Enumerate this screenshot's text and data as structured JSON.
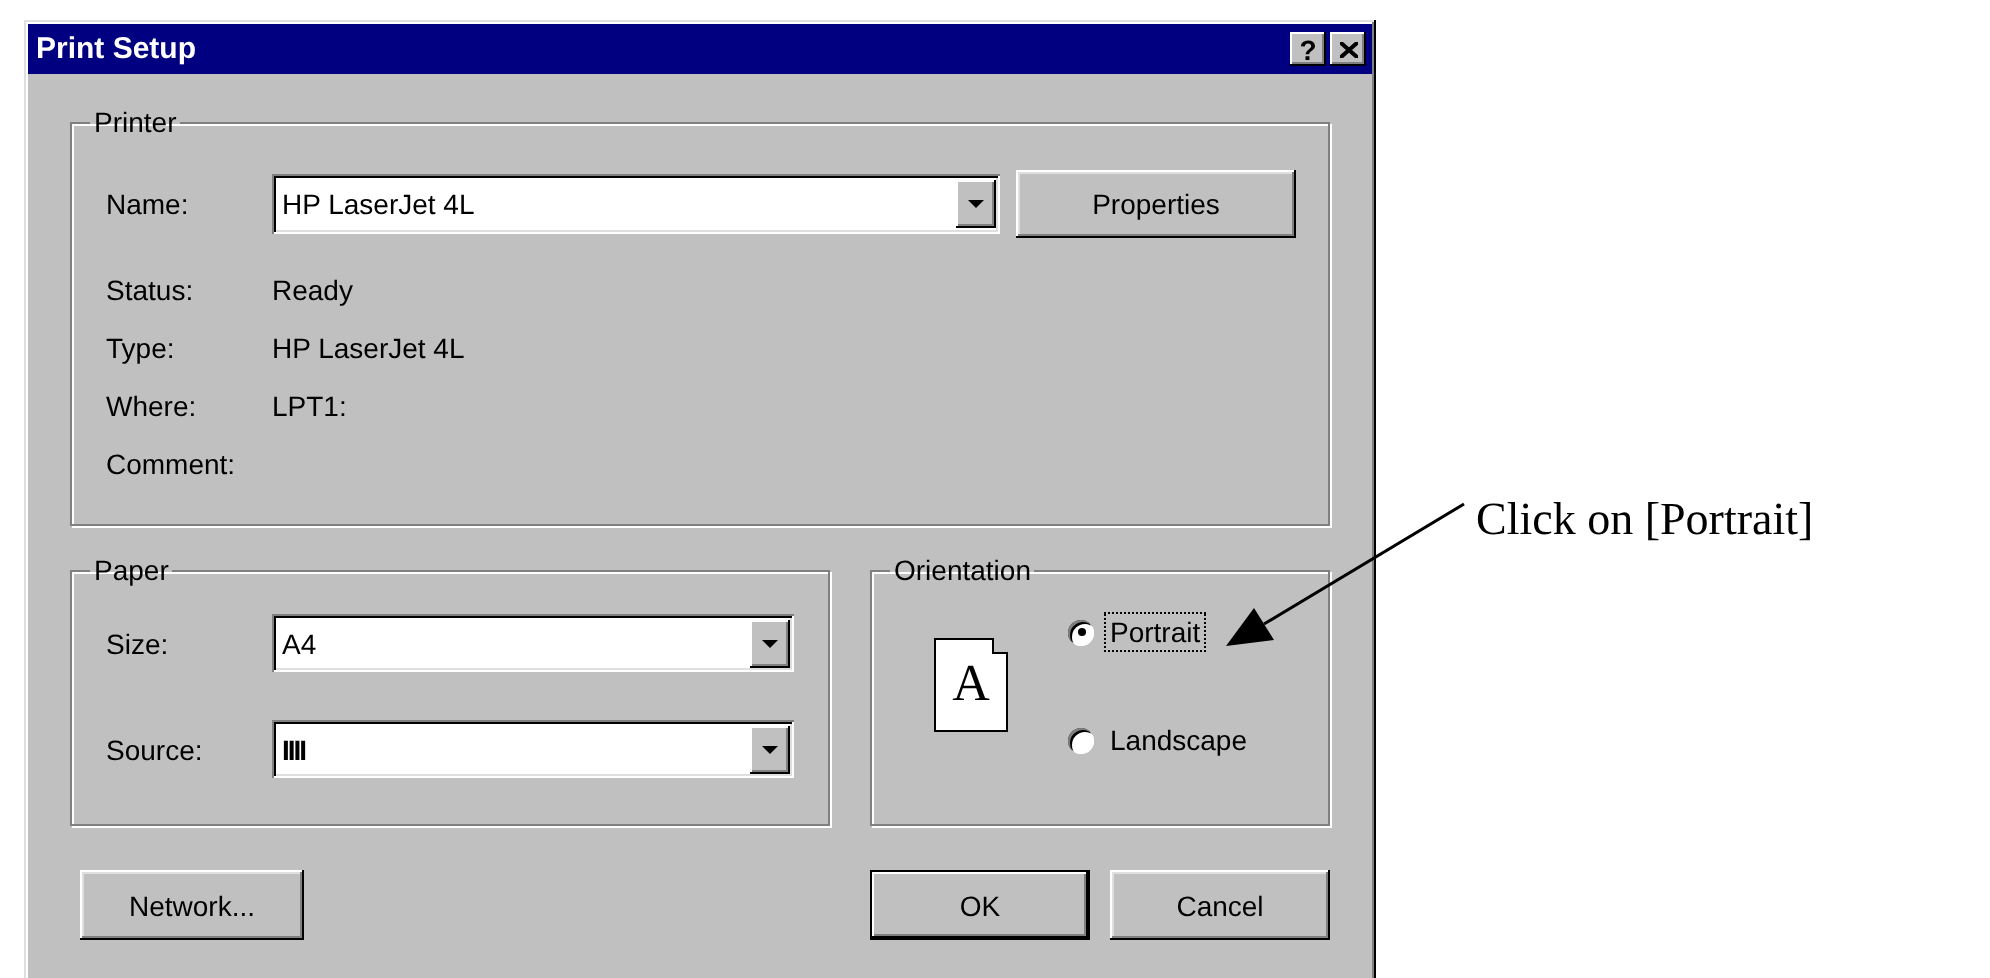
{
  "window": {
    "title": "Print Setup",
    "title_buttons": [
      {
        "kind": "help",
        "label": "?"
      },
      {
        "kind": "close"
      }
    ]
  },
  "printer": {
    "legend": "Printer",
    "name_label": "Name:",
    "name_value": "HP LaserJet 4L",
    "properties": "Properties",
    "info": [
      {
        "label": "Status:",
        "value": "Ready"
      },
      {
        "label": "Type:",
        "value": "HP LaserJet 4L"
      },
      {
        "label": "Where:",
        "value": "LPT1:"
      },
      {
        "label": "Comment:"
      }
    ]
  },
  "paper": {
    "legend": "Paper",
    "fields": [
      {
        "label": "Size:",
        "value": "A4"
      },
      {
        "label": "Source:",
        "value": "IIII"
      }
    ]
  },
  "orientation": {
    "legend": "Orientation",
    "icon_letter": "A",
    "options": [
      {
        "label": "Portrait",
        "selected": true,
        "focused": true
      },
      {
        "label": "Landscape",
        "selected": false,
        "focused": false
      }
    ]
  },
  "footer": {
    "left": [
      {
        "label": "Network...",
        "default": false
      }
    ],
    "right": [
      {
        "label": "OK",
        "default": true
      },
      {
        "label": "Cancel",
        "default": false
      }
    ]
  },
  "annotation": {
    "text": "Click on [Portrait]"
  }
}
